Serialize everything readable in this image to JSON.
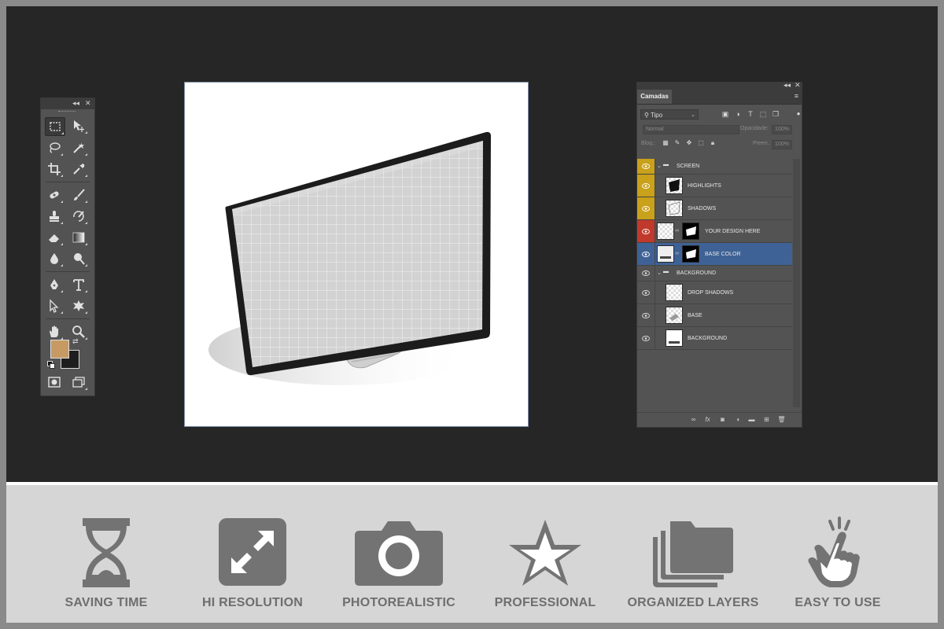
{
  "layers_panel": {
    "tab_label": "Camadas",
    "filter_label": "Tipo",
    "blend_mode": "Normal",
    "opacity_label": "Opacidade:",
    "opacity_value": "100%",
    "lock_label": "Bloq.:",
    "fill_label": "Preen.:",
    "fill_value": "100%",
    "layers": [
      {
        "name": "SCREEN",
        "type": "group",
        "eye_color": "#c9a11a"
      },
      {
        "name": "HIGHLIGHTS",
        "type": "layer",
        "eye_color": "#c9a11a"
      },
      {
        "name": "SHADOWS",
        "type": "layer",
        "eye_color": "#c9a11a"
      },
      {
        "name": "YOUR DESIGN HERE",
        "type": "smart-masked",
        "eye_color": "#c0392b"
      },
      {
        "name": "BASE COLOR",
        "type": "fill-masked",
        "eye_color": "#3f6296",
        "selected": true
      },
      {
        "name": "BACKGROUND",
        "type": "group",
        "eye_color": "#535353"
      },
      {
        "name": "DROP SHADOWS",
        "type": "layer",
        "eye_color": "#535353"
      },
      {
        "name": "BASE",
        "type": "layer",
        "eye_color": "#535353"
      },
      {
        "name": "BACKGROUND",
        "type": "layer",
        "eye_color": "#535353"
      }
    ]
  },
  "toolbox": {
    "foreground_color": "#c69a62",
    "background_color": "#1e1e1e",
    "tools": [
      "rectangular-marquee",
      "move",
      "lasso",
      "magic-wand",
      "crop",
      "eyedropper",
      "spot-healing",
      "brush",
      "clone-stamp",
      "history-brush",
      "eraser",
      "gradient",
      "blur",
      "dodge",
      "pen",
      "type",
      "path-selection",
      "custom-shape",
      "hand",
      "zoom"
    ]
  },
  "features": [
    {
      "label": "SAVING TIME",
      "icon": "hourglass-icon"
    },
    {
      "label": "HI RESOLUTION",
      "icon": "expand-arrows-icon"
    },
    {
      "label": "PHOTOREALISTIC",
      "icon": "camera-icon"
    },
    {
      "label": "PROFESSIONAL",
      "icon": "star-icon"
    },
    {
      "label": "ORGANIZED LAYERS",
      "icon": "folders-icon"
    },
    {
      "label": "EASY TO USE",
      "icon": "hand-pointer-icon"
    }
  ],
  "colors": {
    "workspace": "#262626",
    "panel": "#535353",
    "selection": "#3f6296",
    "footer": "#d6d6d6",
    "feature_gray": "#737373"
  }
}
